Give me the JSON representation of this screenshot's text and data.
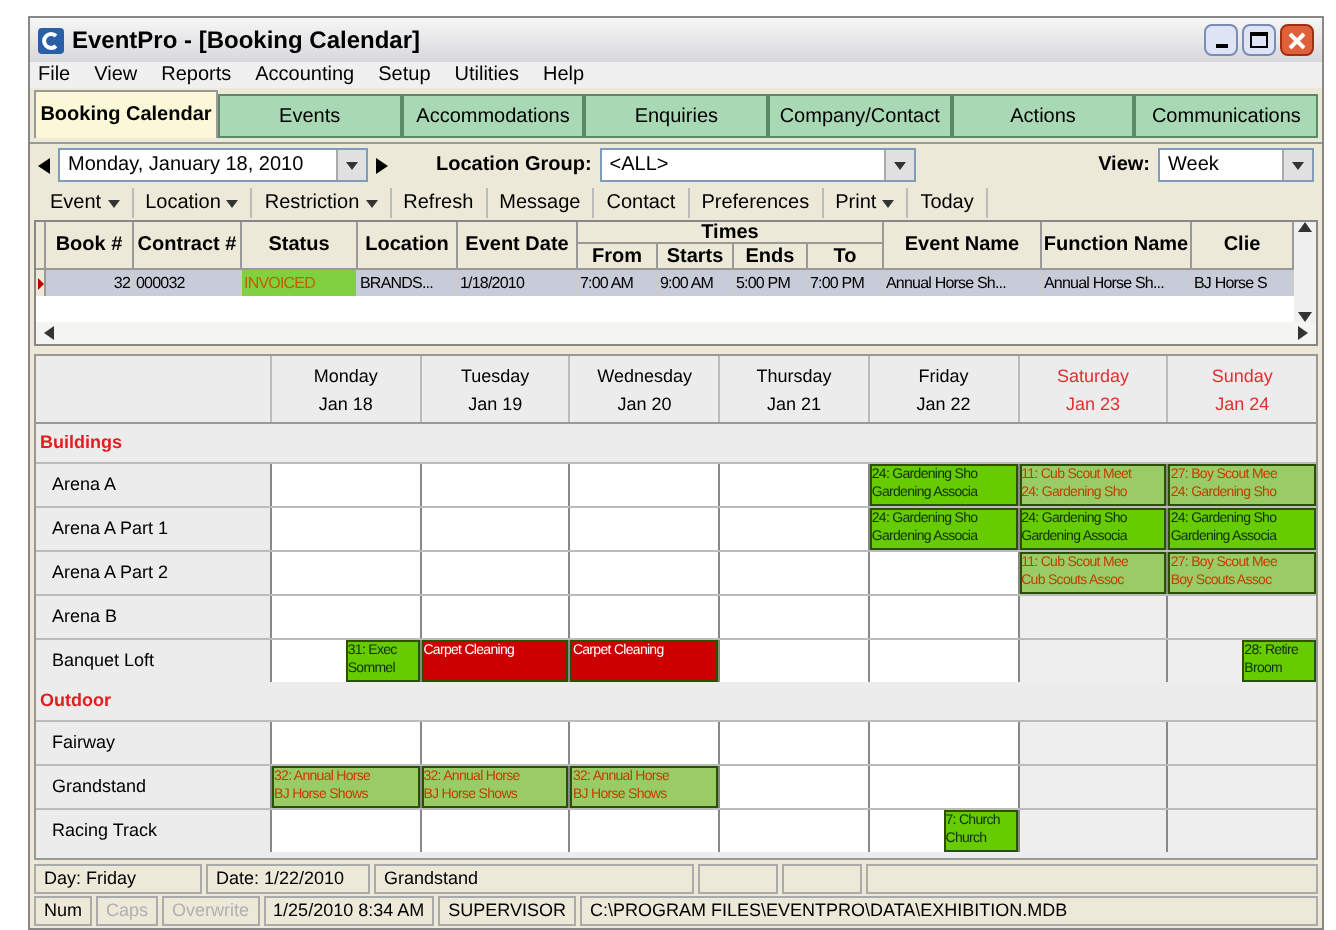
{
  "window": {
    "title": "EventPro - [Booking Calendar]"
  },
  "menu": [
    "File",
    "View",
    "Reports",
    "Accounting",
    "Setup",
    "Utilities",
    "Help"
  ],
  "tabs": [
    {
      "label": "Booking Calendar",
      "selected": true
    },
    {
      "label": "Events",
      "selected": false
    },
    {
      "label": "Accommodations",
      "selected": false
    },
    {
      "label": "Enquiries",
      "selected": false
    },
    {
      "label": "Company/Contact",
      "selected": false
    },
    {
      "label": "Actions",
      "selected": false
    },
    {
      "label": "Communications",
      "selected": false
    }
  ],
  "toolbar": {
    "date": "Monday, January 18, 2010",
    "location_group_label": "Location Group:",
    "location_group": "<ALL>",
    "view_label": "View:",
    "view": "Week"
  },
  "commands": [
    {
      "label": "Event",
      "dropdown": true
    },
    {
      "label": "Location",
      "dropdown": true
    },
    {
      "label": "Restriction",
      "dropdown": true
    },
    {
      "label": "Refresh",
      "dropdown": false
    },
    {
      "label": "Message",
      "dropdown": false
    },
    {
      "label": "Contact",
      "dropdown": false
    },
    {
      "label": "Preferences",
      "dropdown": false
    },
    {
      "label": "Print",
      "dropdown": true
    },
    {
      "label": "Today",
      "dropdown": false
    }
  ],
  "table": {
    "columns": [
      "Book #",
      "Contract #",
      "Status",
      "Location",
      "Event Date",
      "From",
      "Starts",
      "Ends",
      "To",
      "Event Name",
      "Function Name",
      "Clie"
    ],
    "group_heading": "Times",
    "rows": [
      {
        "selected": true,
        "cells": [
          "32",
          "000032",
          "INVOICED",
          "BRANDS...",
          "1/18/2010",
          "7:00 AM",
          "9:00 AM",
          "5:00 PM",
          "7:00 PM",
          "Annual Horse Sh...",
          "Annual Horse Sh...",
          "BJ Horse S"
        ]
      }
    ]
  },
  "calendar": {
    "days": [
      {
        "name": "Monday",
        "date": "Jan 18",
        "weekend": false
      },
      {
        "name": "Tuesday",
        "date": "Jan 19",
        "weekend": false
      },
      {
        "name": "Wednesday",
        "date": "Jan 20",
        "weekend": false
      },
      {
        "name": "Thursday",
        "date": "Jan 21",
        "weekend": false
      },
      {
        "name": "Friday",
        "date": "Jan 22",
        "weekend": false
      },
      {
        "name": "Saturday",
        "date": "Jan 23",
        "weekend": true
      },
      {
        "name": "Sunday",
        "date": "Jan 24",
        "weekend": true
      }
    ],
    "sections": [
      {
        "title": "Buildings",
        "rows": [
          {
            "name": "Arena A",
            "cells": [
              {},
              {},
              {},
              {},
              {
                "bookings": [
                  {
                    "kind": "full",
                    "color": "#66cc00",
                    "lines": [
                      "24: Gardening Sho",
                      "Gardening Associa"
                    ]
                  }
                ]
              },
              {
                "bookings": [
                  {
                    "kind": "full",
                    "color": "#99cc66",
                    "lines": [
                      "11: Cub Scout Meet",
                      "24: Gardening Sho"
                    ]
                  }
                ]
              },
              {
                "bookings": [
                  {
                    "kind": "full",
                    "color": "#99cc66",
                    "lines": [
                      "27: Boy Scout Mee",
                      "24: Gardening Sho"
                    ]
                  }
                ]
              }
            ]
          },
          {
            "name": "Arena A Part 1",
            "cells": [
              {},
              {},
              {},
              {},
              {
                "bookings": [
                  {
                    "kind": "full",
                    "color": "#66cc00",
                    "lines": [
                      "24: Gardening Sho",
                      "Gardening Associa"
                    ]
                  }
                ]
              },
              {
                "bookings": [
                  {
                    "kind": "full",
                    "color": "#66cc00",
                    "lines": [
                      "24: Gardening Sho",
                      "Gardening Associa"
                    ]
                  }
                ]
              },
              {
                "bookings": [
                  {
                    "kind": "full",
                    "color": "#66cc00",
                    "lines": [
                      "24: Gardening Sho",
                      "Gardening Associa"
                    ]
                  }
                ]
              }
            ]
          },
          {
            "name": "Arena A Part 2",
            "cells": [
              {},
              {},
              {},
              {},
              {},
              {
                "bookings": [
                  {
                    "kind": "full",
                    "color": "#99cc66",
                    "lines": [
                      "11: Cub Scout Mee",
                      "Cub Scouts Assoc"
                    ]
                  }
                ]
              },
              {
                "bookings": [
                  {
                    "kind": "full",
                    "color": "#99cc66",
                    "lines": [
                      "27: Boy Scout Mee",
                      "Boy Scouts Assoc"
                    ]
                  }
                ]
              }
            ]
          },
          {
            "name": "Arena B",
            "cells": [
              {},
              {},
              {},
              {},
              {},
              {},
              {}
            ]
          },
          {
            "name": "Banquet Loft",
            "cells": [
              {
                "bookings": [
                  {
                    "kind": "late",
                    "color": "#66cc00",
                    "lines": [
                      "31: Exec",
                      "Sommel"
                    ]
                  }
                ]
              },
              {
                "bookings": [
                  {
                    "kind": "full",
                    "color": "#cc0000",
                    "lines": [
                      "Carpet Cleaning"
                    ]
                  }
                ]
              },
              {
                "bookings": [
                  {
                    "kind": "full",
                    "color": "#cc0000",
                    "lines": [
                      "Carpet Cleaning"
                    ]
                  }
                ]
              },
              {},
              {},
              {},
              {
                "bookings": [
                  {
                    "kind": "late",
                    "color": "#66cc00",
                    "lines": [
                      "28: Retire",
                      "Broom"
                    ]
                  }
                ]
              }
            ]
          }
        ]
      },
      {
        "title": "Outdoor",
        "rows": [
          {
            "name": "Fairway",
            "cells": [
              {},
              {},
              {},
              {},
              {},
              {},
              {}
            ]
          },
          {
            "name": "Grandstand",
            "cells": [
              {
                "bookings": [
                  {
                    "kind": "full",
                    "color": "#99cc66",
                    "lines": [
                      "32: Annual Horse",
                      "BJ Horse Shows"
                    ]
                  }
                ]
              },
              {
                "bookings": [
                  {
                    "kind": "full",
                    "color": "#99cc66",
                    "lines": [
                      "32: Annual Horse",
                      "BJ Horse Shows"
                    ]
                  }
                ]
              },
              {
                "bookings": [
                  {
                    "kind": "full",
                    "color": "#99cc66",
                    "lines": [
                      "32: Annual Horse",
                      "BJ Horse Shows"
                    ]
                  }
                ]
              },
              {},
              {},
              {},
              {}
            ]
          },
          {
            "name": "Racing Track",
            "cells": [
              {},
              {},
              {},
              {},
              {
                "bookings": [
                  {
                    "kind": "late",
                    "color": "#66cc00",
                    "lines": [
                      "7: Church",
                      "Church"
                    ]
                  }
                ]
              },
              {},
              {}
            ]
          }
        ]
      }
    ]
  },
  "status_bar": {
    "day": "Day: Friday",
    "date": "Date: 1/22/2010",
    "location": "Grandstand"
  },
  "status_bar_2": [
    {
      "text": "Num",
      "disabled": false
    },
    {
      "text": "Caps",
      "disabled": true
    },
    {
      "text": "Overwrite",
      "disabled": true
    },
    {
      "text": "1/25/2010 8:34 AM",
      "disabled": false
    },
    {
      "text": "SUPERVISOR",
      "disabled": false
    },
    {
      "text": "C:\\PROGRAM FILES\\EVENTPRO\\DATA\\EXHIBITION.MDB",
      "disabled": false
    }
  ]
}
